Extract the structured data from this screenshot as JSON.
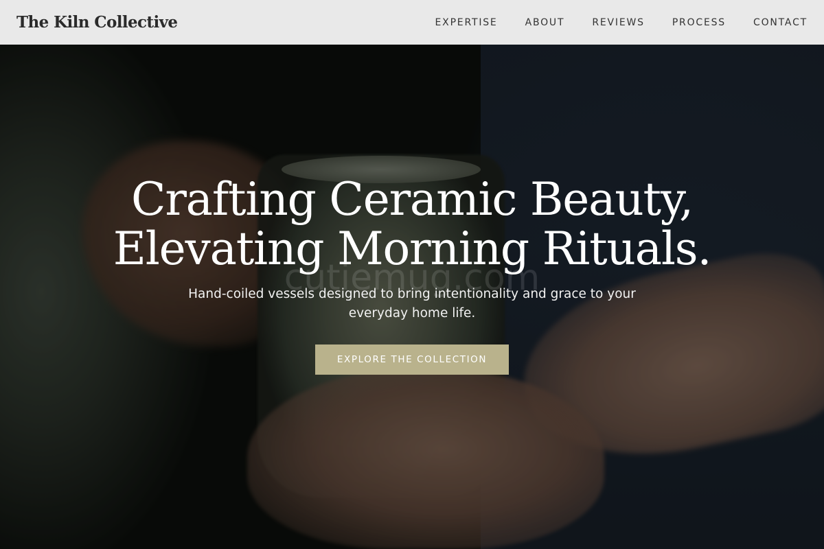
{
  "header": {
    "brand": "The Kiln Collective",
    "nav": [
      {
        "label": "EXPERTISE"
      },
      {
        "label": "ABOUT"
      },
      {
        "label": "REVIEWS"
      },
      {
        "label": "PROCESS"
      },
      {
        "label": "CONTACT"
      }
    ]
  },
  "hero": {
    "title_line1": "Crafting Ceramic Beauty,",
    "title_line2": "Elevating Morning Rituals.",
    "subtitle_line1": "Hand-coiled vessels designed to bring intentionality and grace to your",
    "subtitle_line2": "everyday home life.",
    "cta_label": "EXPLORE THE COLLECTION",
    "watermark": "cutiemug.com"
  },
  "colors": {
    "header_bg": "#e9e9e9",
    "cta_bg": "#b9b28c",
    "text_light": "#ffffff"
  }
}
